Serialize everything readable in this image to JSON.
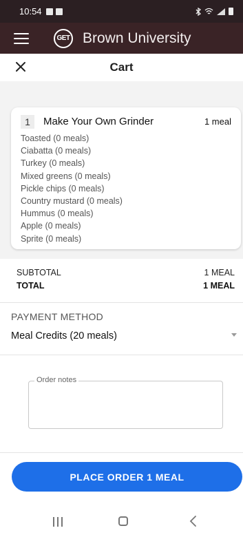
{
  "status_bar": {
    "time": "10:54"
  },
  "app_bar": {
    "logo_text": "GET",
    "title": "Brown University"
  },
  "cart": {
    "title": "Cart"
  },
  "item": {
    "qty": "1",
    "name": "Make Your Own Grinder",
    "price": "1 meal",
    "modifiers": [
      "Toasted (0 meals)",
      "Ciabatta (0 meals)",
      "Turkey (0 meals)",
      "Mixed greens (0 meals)",
      "Pickle chips (0 meals)",
      "Country mustard (0 meals)",
      "Hummus (0 meals)",
      "Apple (0 meals)",
      "Sprite (0 meals)"
    ]
  },
  "totals": {
    "subtotal_label": "SUBTOTAL",
    "subtotal_value": "1 MEAL",
    "total_label": "TOTAL",
    "total_value": "1 MEAL"
  },
  "payment": {
    "label": "PAYMENT METHOD",
    "selected": "Meal Credits (20 meals)"
  },
  "notes": {
    "label": "Order notes"
  },
  "place_order": {
    "label": "PLACE ORDER 1 MEAL"
  },
  "colors": {
    "app_bar": "#3a2326",
    "status_bar": "#2b1f22",
    "accent": "#1e6fe8"
  }
}
